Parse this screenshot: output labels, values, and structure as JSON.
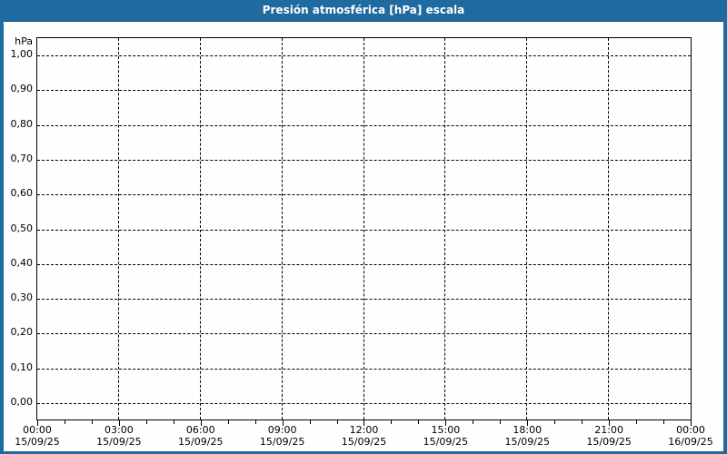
{
  "window": {
    "title": "Presión atmosférica [hPa] escala"
  },
  "colors": {
    "titlebar": "#1f6a9e",
    "window_border": "#1f6a9e",
    "title_text": "#ffffff",
    "grid": "#000000",
    "plot_background": "#fefefe"
  },
  "chart_data": {
    "type": "line",
    "title": "Presión atmosférica [hPa] escala",
    "ylabel": "hPa",
    "xlabel": "",
    "ylim": [
      0.0,
      1.0
    ],
    "y_tick_step": 0.1,
    "y_ticks": [
      "1,00",
      "0,90",
      "0,80",
      "0,70",
      "0,60",
      "0,50",
      "0,40",
      "0,30",
      "0,20",
      "0,10",
      "0,00"
    ],
    "x_ticks": [
      {
        "time": "00:00",
        "date": "15/09/25"
      },
      {
        "time": "03:00",
        "date": "15/09/25"
      },
      {
        "time": "06:00",
        "date": "15/09/25"
      },
      {
        "time": "09:00",
        "date": "15/09/25"
      },
      {
        "time": "12:00",
        "date": "15/09/25"
      },
      {
        "time": "15:00",
        "date": "15/09/25"
      },
      {
        "time": "18:00",
        "date": "15/09/25"
      },
      {
        "time": "21:00",
        "date": "15/09/25"
      },
      {
        "time": "00:00",
        "date": "16/09/25"
      }
    ],
    "minor_ticks_per_major": 3,
    "grid": "dashed",
    "legend": "none",
    "series": []
  }
}
